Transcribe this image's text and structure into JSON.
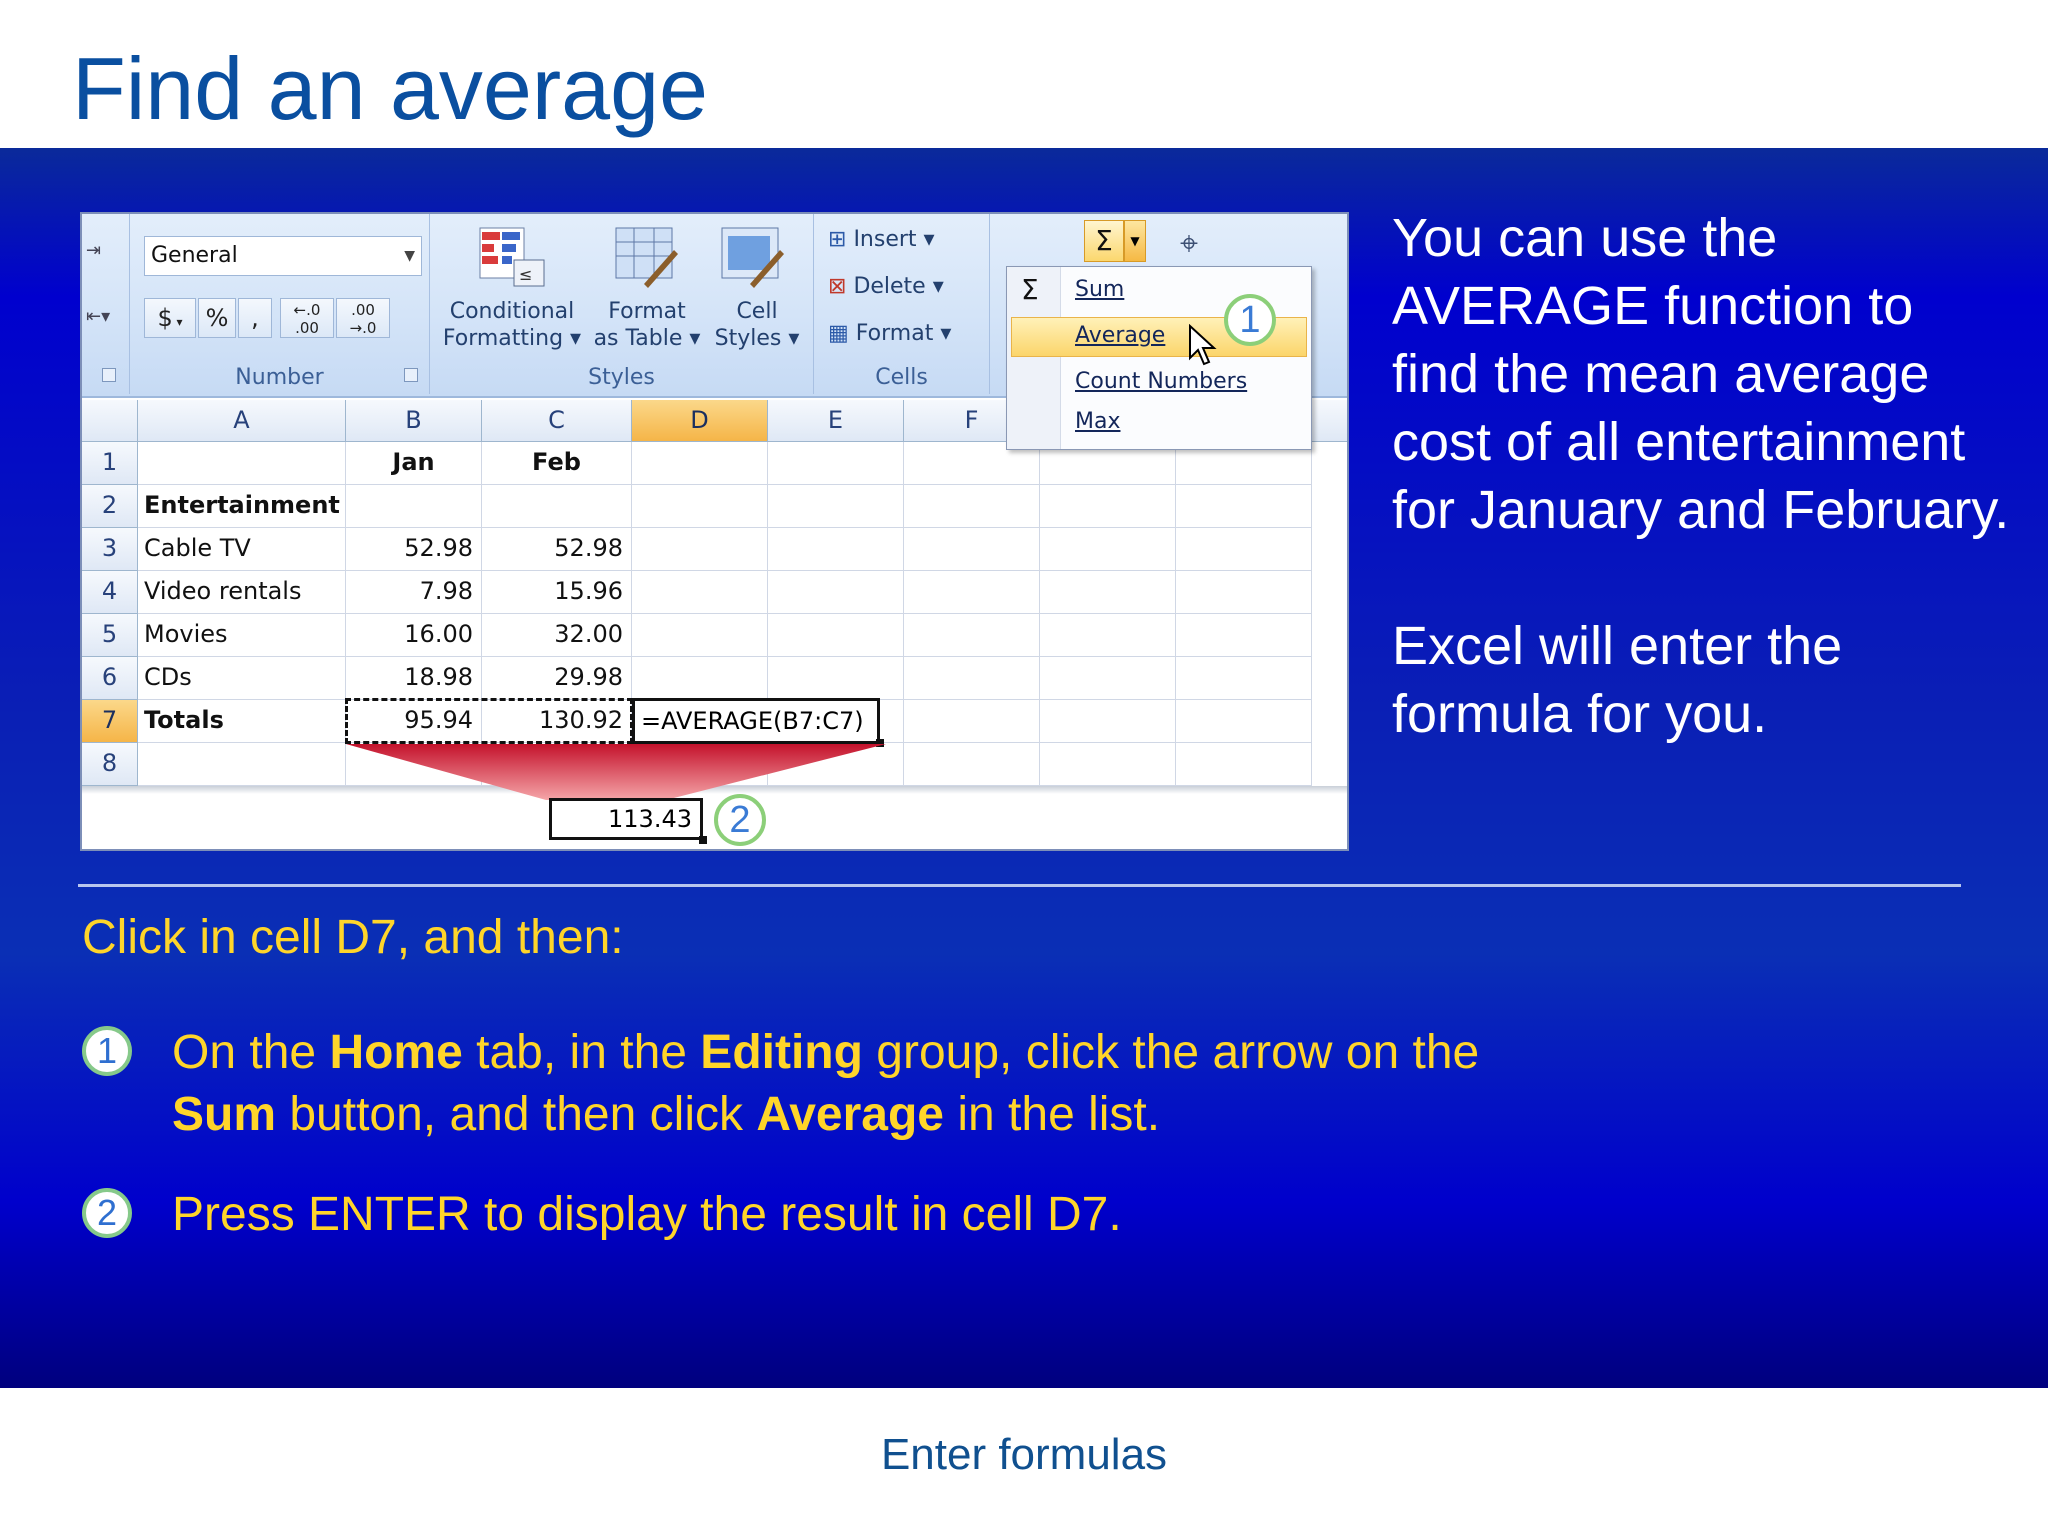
{
  "slide": {
    "title": "Find an average",
    "footer": "Enter formulas",
    "description": [
      "You can use the AVERAGE function to find the mean average cost of all entertainment for January and February.",
      "Excel will enter the formula for you."
    ],
    "intro": "Click in cell D7, and then:",
    "steps": [
      {
        "num": "1",
        "parts": [
          {
            "t": "On the ",
            "b": false
          },
          {
            "t": "Home",
            "b": true
          },
          {
            "t": " tab, in the ",
            "b": false
          },
          {
            "t": "Editing",
            "b": true
          },
          {
            "t": " group, click the arrow on the ",
            "b": false
          },
          {
            "t": "Sum",
            "b": true
          },
          {
            "t": " button, and then click ",
            "b": false
          },
          {
            "t": "Average",
            "b": true
          },
          {
            "t": " in the list.",
            "b": false
          }
        ]
      },
      {
        "num": "2",
        "parts": [
          {
            "t": "Press ENTER to display the result in cell D7.",
            "b": false
          }
        ]
      }
    ]
  },
  "ribbon": {
    "number_format": "General",
    "number_buttons": [
      "$",
      "%",
      ","
    ],
    "decimal_buttons": [
      "←.0 .00",
      ".00 →.0"
    ],
    "groups": {
      "number": "Number",
      "styles": "Styles",
      "cells": "Cells"
    },
    "styles_buttons": {
      "conditional": [
        "Conditional",
        "Formatting ▾"
      ],
      "format_table": [
        "Format",
        "as Table ▾"
      ],
      "cell_styles": [
        "Cell",
        "Styles ▾"
      ]
    },
    "cells_buttons": [
      "Insert ▾",
      "Delete ▾",
      "Format ▾"
    ],
    "sigma": "Σ",
    "menu": [
      "Sum",
      "Average",
      "Count Numbers",
      "Max"
    ]
  },
  "sheet": {
    "columns": [
      "A",
      "B",
      "C",
      "D",
      "E",
      "F"
    ],
    "rows": [
      {
        "n": "1",
        "a": "",
        "b": "Jan",
        "c": "Feb"
      },
      {
        "n": "2",
        "a": "Entertainment",
        "b": "",
        "c": ""
      },
      {
        "n": "3",
        "a": "Cable TV",
        "b": "52.98",
        "c": "52.98"
      },
      {
        "n": "4",
        "a": "Video rentals",
        "b": "7.98",
        "c": "15.96"
      },
      {
        "n": "5",
        "a": "Movies",
        "b": "16.00",
        "c": "32.00"
      },
      {
        "n": "6",
        "a": "CDs",
        "b": "18.98",
        "c": "29.98"
      },
      {
        "n": "7",
        "a": "Totals",
        "b": "95.94",
        "c": "130.92"
      },
      {
        "n": "8",
        "a": "",
        "b": "",
        "c": ""
      }
    ],
    "formula": "=AVERAGE(B7:C7)",
    "result": "113.43",
    "callouts": [
      "1",
      "2"
    ]
  },
  "colors": {
    "title": "#0a4fa0",
    "band": "#0a1fb5",
    "instructions": "#ffd52a",
    "callout_ring": "#8ccf79"
  }
}
